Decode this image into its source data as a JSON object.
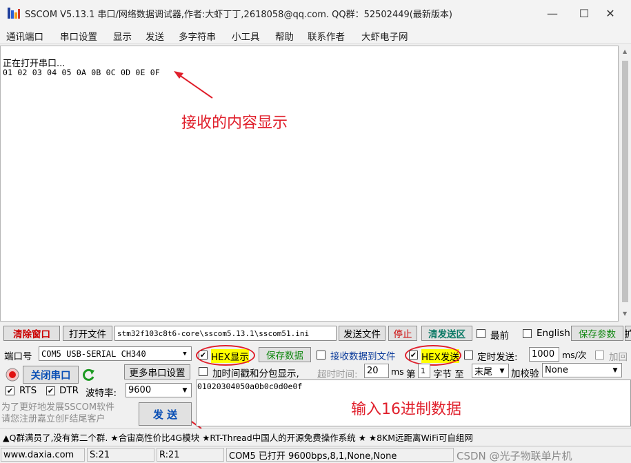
{
  "window": {
    "title": "SSCOM V5.13.1 串口/网络数据调试器,作者:大虾丁丁,2618058@qq.com. QQ群：52502449(最新版本)",
    "minimize": "—",
    "maximize": "☐",
    "close": "✕"
  },
  "menu": [
    "通讯端口",
    "串口设置",
    "显示",
    "发送",
    "多字符串",
    "小工具",
    "帮助",
    "联系作者",
    "大虾电子网"
  ],
  "receive": {
    "line1": "正在打开串口...",
    "line2": "01 02 03 04 05 0A 0B 0C 0D 0E 0F"
  },
  "annotations": {
    "receive_note": "接收的内容显示",
    "input_note": "输入16进制数据"
  },
  "toolbar": {
    "clear_window": "清除窗口",
    "open_file": "打开文件",
    "file_path": "stm32f103c8t6-core\\sscom5.13.1\\sscom51.ini",
    "send_file": "发送文件",
    "stop": "停止",
    "clear_send": "清发送区",
    "front_label": "最前",
    "english_label": "English",
    "save_params": "保存参数",
    "more": "扩"
  },
  "port": {
    "port_label": "端口号",
    "port_value": "COM5 USB-SERIAL CH340",
    "close_port": "关闭串口",
    "more_settings": "更多串口设置",
    "rts_label": "RTS",
    "dtr_label": "DTR",
    "baud_label": "波特率:",
    "baud_value": "9600",
    "promo": "为了更好地发展SSCOM软件\n请您注册嘉立创F结尾客户"
  },
  "options": {
    "hex_display": "HEX显示",
    "save_data": "保存数据",
    "recv_to_file": "接收数据到文件",
    "hex_send": "HEX发送",
    "timed_send": "定时发送:",
    "interval_value": "1000",
    "interval_unit": "ms/次",
    "add_label": "加回",
    "timestamp_label": "加时间戳和分包显示,",
    "timeout_label": "超时时间:",
    "timeout_value": "20",
    "timeout_unit": "ms",
    "nth_label": "第",
    "nth_value": "1",
    "byte_label": "字节 至",
    "end_value": "末尾",
    "checksum_label": "加校验",
    "checksum_value": "None"
  },
  "send": {
    "input_value": "01020304050a0b0c0d0e0f",
    "send_button": "发 送"
  },
  "ad_text": "▲Q群满员了,没有第二个群. ★合宙高性价比4G模块 ★RT-Thread中国人的开源免费操作系统 ★ ★8KM远距离WiFi可自组网",
  "status": {
    "site": "www.daxia.com",
    "sent": "S:21",
    "received": "R:21",
    "port_status": "COM5 已打开  9600bps,8,1,None,None",
    "watermark": "CSDN @光子物联单片机"
  },
  "colors": {
    "annotation": "#e0202c",
    "hex_highlight": "#ffff00"
  }
}
